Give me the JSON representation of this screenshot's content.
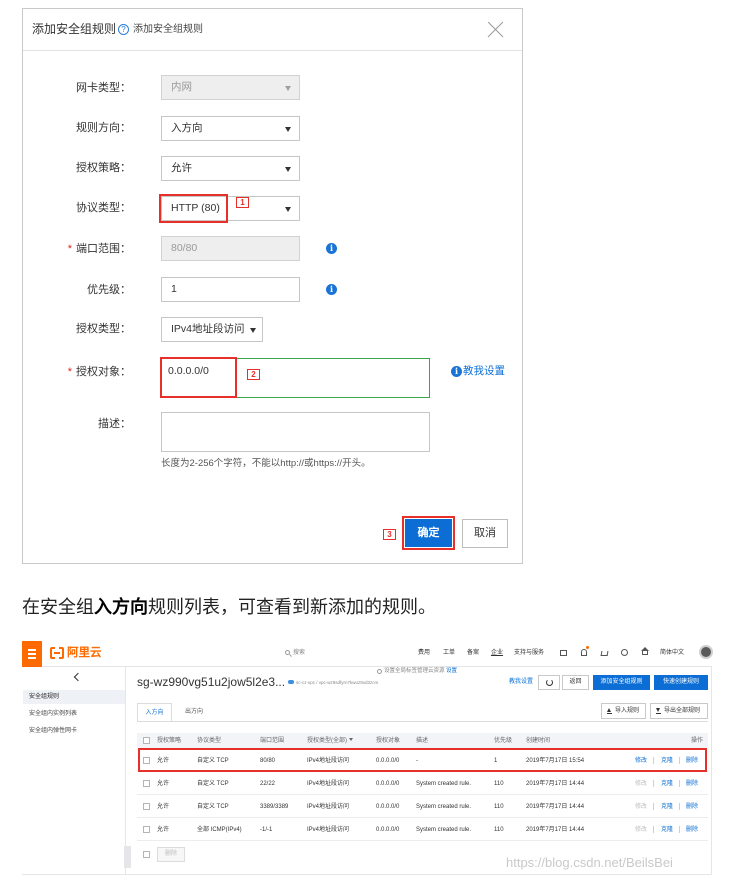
{
  "dialog": {
    "title": "添加安全组规则",
    "help_icon": "question-circle-icon",
    "help_glyph": "?",
    "help_text": "添加安全组规则",
    "close_icon": "close-icon",
    "fields": {
      "nic_type": {
        "label": "网卡类型：",
        "value": "内网",
        "disabled": true
      },
      "direction": {
        "label": "规则方向：",
        "value": "入方向"
      },
      "policy": {
        "label": "授权策略：",
        "value": "允许"
      },
      "protocol": {
        "label": "协议类型：",
        "value": "HTTP (80)",
        "marker": "1"
      },
      "port_range": {
        "required_mark": "*",
        "label": "端口范围：",
        "value": "80/80",
        "disabled": true,
        "info_glyph": "i"
      },
      "priority": {
        "label": "优先级：",
        "value": "1",
        "info_glyph": "i"
      },
      "auth_type": {
        "label": "授权类型：",
        "value": "IPv4地址段访问"
      },
      "auth_object": {
        "required_mark": "*",
        "label": "授权对象：",
        "value": "0.0.0.0/0",
        "marker": "2",
        "info_glyph": "i",
        "help_link": "教我设置"
      },
      "description": {
        "label": "描述：",
        "hint": "长度为2-256个字符，不能以http://或https://开头。"
      }
    },
    "confirm": {
      "label": "确定",
      "marker": "3"
    },
    "cancel": {
      "label": "取消"
    }
  },
  "caption": {
    "before": "在安全组",
    "bold": "入方向",
    "after": "规则列表，可查看到新添加的规则。"
  },
  "console": {
    "brand": {
      "name": "阿里云",
      "logo_icon": "aliyun-logo-icon",
      "menu_icon": "hamburger-icon",
      "color": "#ff6a00"
    },
    "search": {
      "placeholder": "搜索",
      "icon": "search-icon"
    },
    "nav": [
      "费用",
      "工单",
      "备案",
      "企业",
      "支持与服务"
    ],
    "nav_icons": [
      "message-icon",
      "bell-icon",
      "cart-icon",
      "help-icon",
      "home-icon"
    ],
    "language": "简体中文",
    "sidebar": {
      "back_icon": "chevron-left-icon",
      "items": [
        "安全组规则",
        "安全组内实例列表",
        "安全组内弹性网卡"
      ],
      "active": 0
    },
    "header": {
      "title": "sg-wz990vg51u2jow5l2e3...",
      "vpc": "sc-cz-vpc / vpc-wz9sdfyrn7kwuz9xd3zcm",
      "tag_notice": "设置全局标签管理云资源",
      "tag_link": "设置",
      "help_link": "教我设置",
      "back_label": "返回",
      "add_rule_label": "添加安全组规则",
      "quick_create_label": "快速创建规则"
    },
    "tabs": [
      "入方向",
      "出方向"
    ],
    "active_tab": 0,
    "import_label": "导入规则",
    "export_label": "导出全部规则",
    "table": {
      "columns": [
        "授权策略",
        "协议类型",
        "端口范围",
        "授权类型(全部)",
        "授权对象",
        "描述",
        "优先级",
        "创建时间",
        "操作"
      ],
      "rows": [
        {
          "policy": "允许",
          "protocol": "自定义 TCP",
          "port": "80/80",
          "auth_type": "IPv4地址段访问",
          "object": "0.0.0.0/0",
          "description": "-",
          "priority": "1",
          "created": "2019年7月17日 15:54",
          "ops": [
            "修改",
            "克隆",
            "删除"
          ],
          "edit_disabled": false,
          "highlighted": true
        },
        {
          "policy": "允许",
          "protocol": "自定义 TCP",
          "port": "22/22",
          "auth_type": "IPv4地址段访问",
          "object": "0.0.0.0/0",
          "description": "System created rule.",
          "priority": "110",
          "created": "2019年7月17日 14:44",
          "ops": [
            "修改",
            "克隆",
            "删除"
          ],
          "edit_disabled": true
        },
        {
          "policy": "允许",
          "protocol": "自定义 TCP",
          "port": "3389/3389",
          "auth_type": "IPv4地址段访问",
          "object": "0.0.0.0/0",
          "description": "System created rule.",
          "priority": "110",
          "created": "2019年7月17日 14:44",
          "ops": [
            "修改",
            "克隆",
            "删除"
          ],
          "edit_disabled": true
        },
        {
          "policy": "允许",
          "protocol": "全部 ICMP(IPv4)",
          "port": "-1/-1",
          "auth_type": "IPv4地址段访问",
          "object": "0.0.0.0/0",
          "description": "System created rule.",
          "priority": "110",
          "created": "2019年7月17日 14:44",
          "ops": [
            "修改",
            "克隆",
            "删除"
          ],
          "edit_disabled": true
        }
      ]
    },
    "bulk_delete_label": "删除",
    "accent": "#0c6ed4",
    "highlight": "#e8302a"
  },
  "watermark": "https://blog.csdn.net/BeilsBei"
}
